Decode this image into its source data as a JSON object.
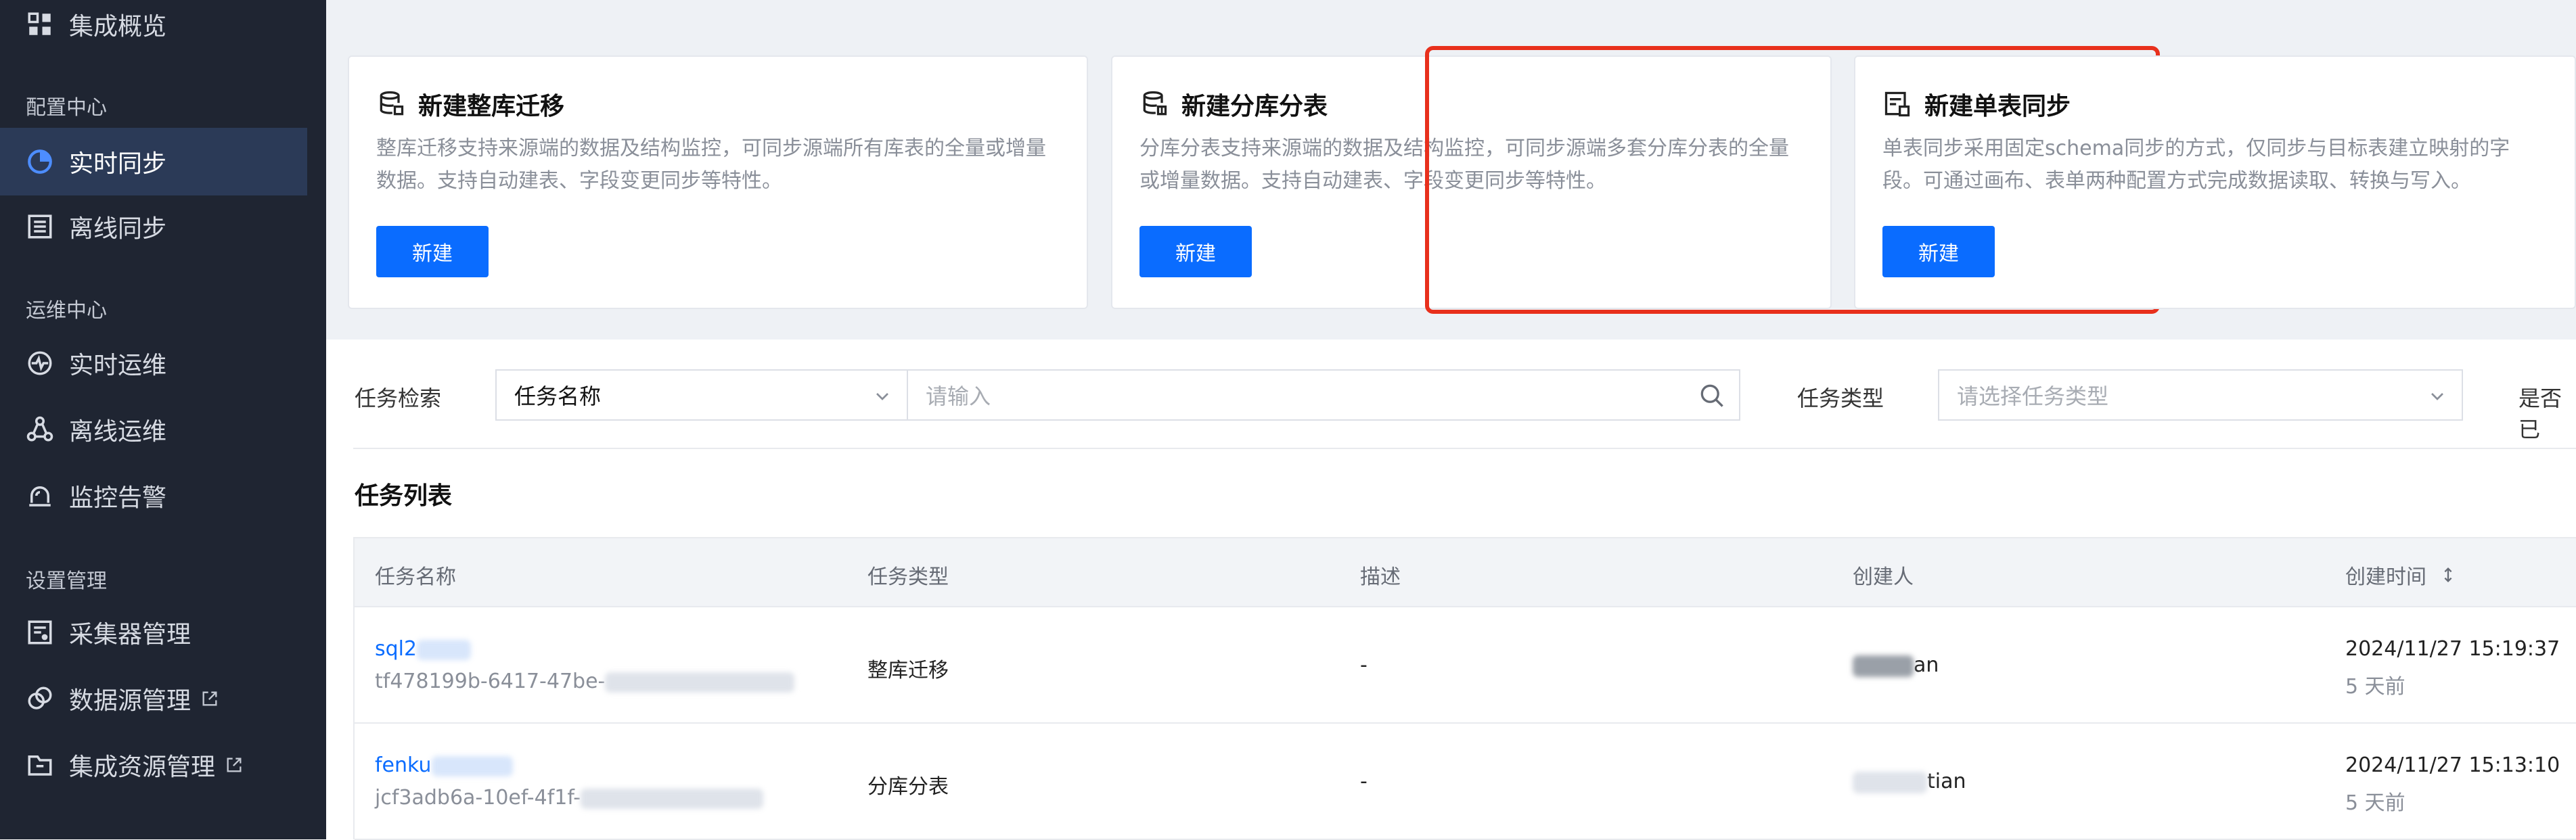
{
  "sidebar": {
    "items": [
      {
        "label": "集成概览",
        "icon": "grid-icon"
      },
      {
        "label": "实时同步",
        "icon": "pie-clock-icon",
        "active": true
      },
      {
        "label": "离线同步",
        "icon": "list-icon"
      },
      {
        "label": "实时运维",
        "icon": "pulse-icon"
      },
      {
        "label": "离线运维",
        "icon": "nodes-icon"
      },
      {
        "label": "监控告警",
        "icon": "alarm-icon"
      },
      {
        "label": "采集器管理",
        "icon": "collector-icon"
      },
      {
        "label": "数据源管理",
        "icon": "datasource-icon",
        "external": true
      },
      {
        "label": "集成资源管理",
        "icon": "folder-icon",
        "external": true
      }
    ],
    "sections": [
      "配置中心",
      "运维中心",
      "设置管理"
    ]
  },
  "cards": [
    {
      "title": "新建整库迁移",
      "desc": "整库迁移支持来源端的数据及结构监控，可同步源端所有库表的全量或增量数据。支持自动建表、字段变更同步等特性。",
      "button": "新建",
      "icon": "database-icon"
    },
    {
      "title": "新建分库分表",
      "desc": "分库分表支持来源端的数据及结构监控，可同步源端多套分库分表的全量或增量数据。支持自动建表、字段变更同步等特性。",
      "button": "新建",
      "icon": "database-split-icon"
    },
    {
      "title": "新建单表同步",
      "desc": "单表同步采用固定schema同步的方式，仅同步与目标表建立映射的字段。可通过画布、表单两种配置方式完成数据读取、转换与写入。",
      "button": "新建",
      "icon": "table-sync-icon"
    }
  ],
  "filters": {
    "search_label": "任务检索",
    "search_field": "任务名称",
    "search_placeholder": "请输入",
    "type_label": "任务类型",
    "type_placeholder": "请选择任务类型",
    "truncated_label": "是否已"
  },
  "task_list": {
    "title": "任务列表",
    "columns": [
      "任务名称",
      "任务类型",
      "描述",
      "创建人",
      "创建时间"
    ],
    "rows": [
      {
        "name": "sql2",
        "id": "tf478199b-6417-47be-",
        "type": "整库迁移",
        "desc": "-",
        "creator": "an",
        "time": "2024/11/27 15:19:37",
        "ago": "5 天前"
      },
      {
        "name": "fenku",
        "id": "jcf3adb6a-10ef-4f1f-",
        "type": "分库分表",
        "desc": "-",
        "creator": "tian",
        "time": "2024/11/27 15:13:10",
        "ago": "5 天前"
      }
    ]
  },
  "colors": {
    "sidebar_bg": "#1f2532",
    "sidebar_active": "#2b3a57",
    "primary": "#0a6cff",
    "highlight": "#e8301c"
  }
}
